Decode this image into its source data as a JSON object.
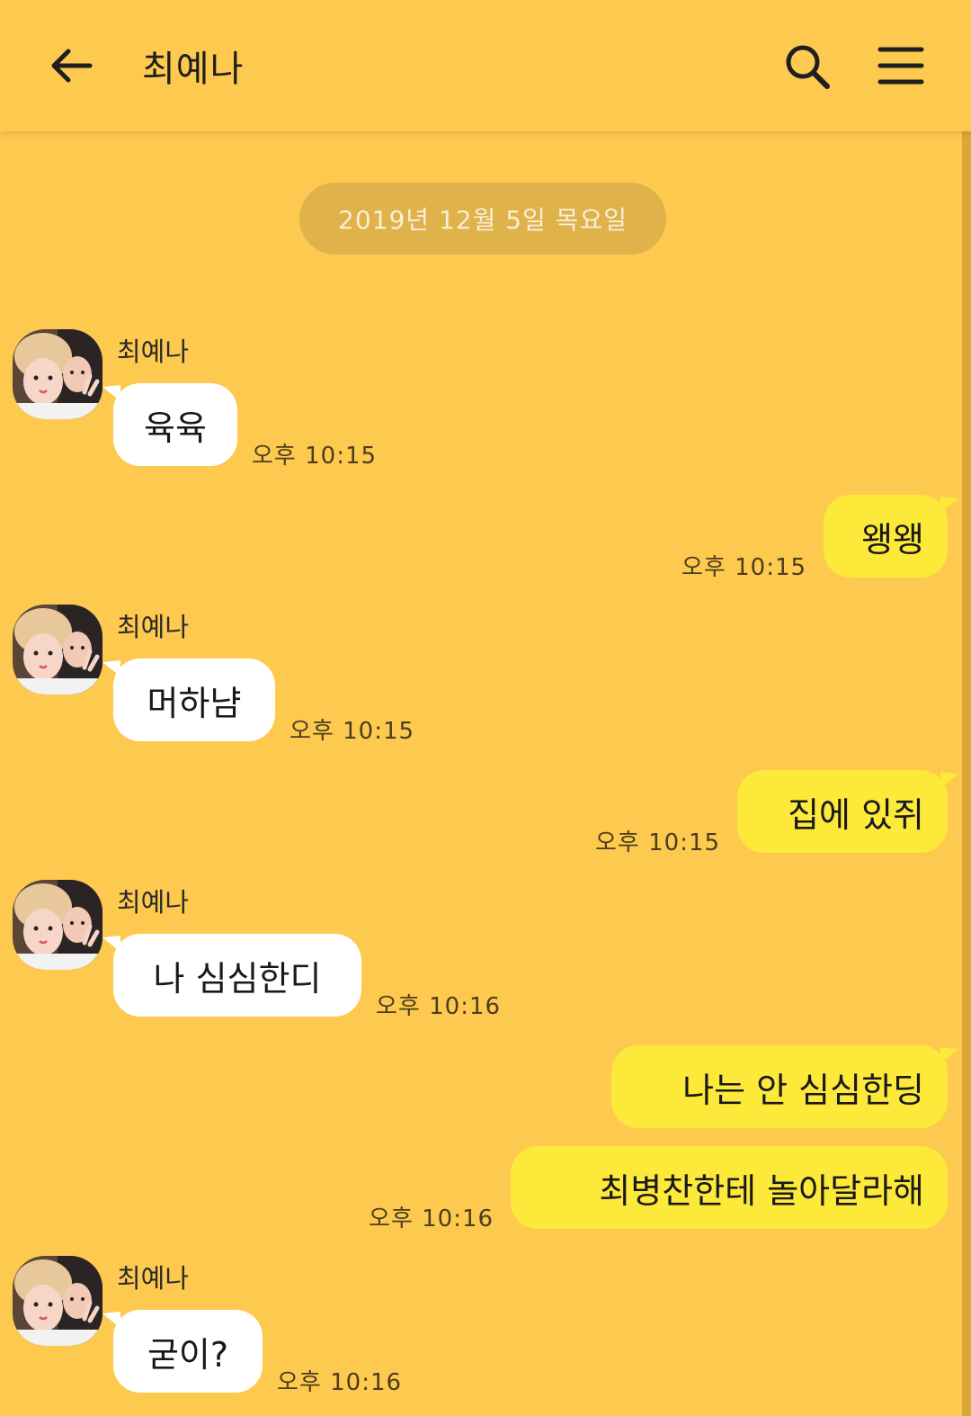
{
  "header": {
    "title": "최예나"
  },
  "date_divider": "2019년 12월 5일 목요일",
  "colors": {
    "background": "#fec94f",
    "incoming_bubble": "#ffffff",
    "outgoing_bubble": "#fde93a",
    "date_chip": "#dfb24a"
  },
  "icons": {
    "back": "arrow-left-icon",
    "search": "search-icon",
    "menu": "hamburger-menu-icon"
  },
  "messages": [
    {
      "direction": "in",
      "sender": "최예나",
      "text": "육육",
      "time": "오후 10:15"
    },
    {
      "direction": "out",
      "text": "왱왱",
      "time": "오후 10:15"
    },
    {
      "direction": "in",
      "sender": "최예나",
      "text": "머하냠",
      "time": "오후 10:15"
    },
    {
      "direction": "out",
      "text": "집에 있쥐",
      "time": "오후 10:15"
    },
    {
      "direction": "in",
      "sender": "최예나",
      "text": "나 심심한디",
      "time": "오후 10:16"
    },
    {
      "direction": "out",
      "text": "나는 안 심심한딩",
      "time": ""
    },
    {
      "direction": "out",
      "text": "최병찬한테 놀아달라해",
      "time": "오후 10:16"
    },
    {
      "direction": "in",
      "sender": "최예나",
      "text": "굳이?",
      "time": "오후 10:16"
    }
  ]
}
